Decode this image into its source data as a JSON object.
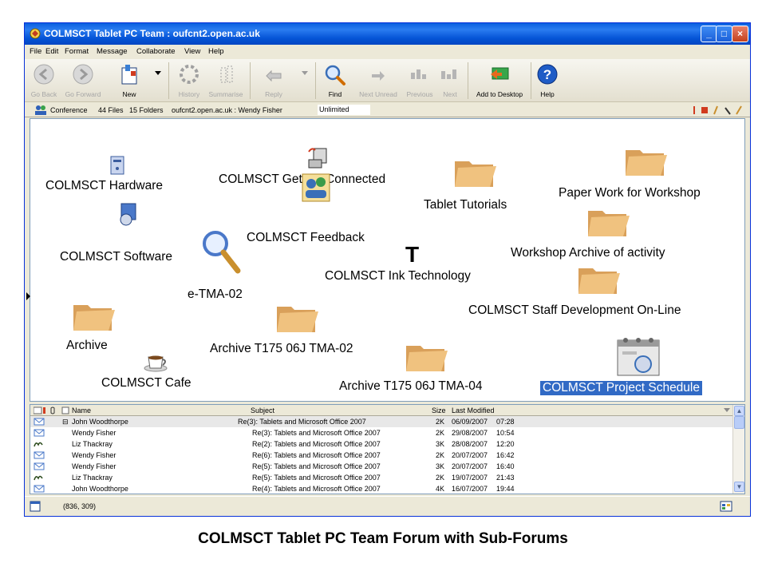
{
  "window": {
    "title": "COLMSCT Tablet PC Team : oufcnt2.open.ac.uk"
  },
  "menu": [
    "File",
    "Edit",
    "Format",
    "Message",
    "Collaborate",
    "View",
    "Help"
  ],
  "toolbar": {
    "go_back": "Go Back",
    "go_forward": "Go Forward",
    "new": "New",
    "history": "History",
    "summarise": "Summarise",
    "reply": "Reply",
    "find": "Find",
    "next_unread": "Next Unread",
    "previous": "Previous",
    "next": "Next",
    "add_to_desktop": "Add to Desktop",
    "help": "Help"
  },
  "infobar": {
    "type": "Conference",
    "files": "44 Files",
    "folders": "15 Folders",
    "location": "oufcnt2.open.ac.uk : Wendy Fisher",
    "quota": "Unlimited"
  },
  "forum": {
    "items": {
      "hardware": "COLMSCT Hardware",
      "getting_connected": "COLMSCT Getting Connected",
      "tablet_tutorials": "Tablet Tutorials",
      "paper_work": "Paper Work for Workshop",
      "feedback": "COLMSCT Feedback",
      "software": "COLMSCT Software",
      "workshop_archive": "Workshop Archive of activity",
      "etma": "e-TMA-02",
      "ink_tech": "COLMSCT Ink Technology",
      "staff_dev": "COLMSCT Staff Development On-Line",
      "archive": "Archive",
      "archive_tma02": "Archive T175 06J TMA-02",
      "cafe": "COLMSCT Cafe",
      "archive_tma04": "Archive T175 06J TMA-04",
      "project_schedule": "COLMSCT Project Schedule"
    },
    "big_letter": "T"
  },
  "messages": {
    "headers": {
      "name": "Name",
      "subject": "Subject",
      "size": "Size",
      "modified": "Last Modified"
    },
    "rows": [
      {
        "name": "John Woodthorpe",
        "subject": "Re(3): Tablets and Microsoft Office 2007",
        "size": "2K",
        "date": "06/09/2007",
        "time": "07:28",
        "icon": "message-icon"
      },
      {
        "name": "Wendy Fisher",
        "subject": "Re(3): Tablets and Microsoft Office 2007",
        "size": "2K",
        "date": "29/08/2007",
        "time": "10:54",
        "icon": "message-icon"
      },
      {
        "name": "Liz Thackray",
        "subject": "Re(2): Tablets and Microsoft Office 2007",
        "size": "3K",
        "date": "28/08/2007",
        "time": "12:20",
        "icon": "ink-icon"
      },
      {
        "name": "Wendy Fisher",
        "subject": "Re(6): Tablets and Microsoft Office 2007",
        "size": "2K",
        "date": "20/07/2007",
        "time": "16:42",
        "icon": "message-icon"
      },
      {
        "name": "Wendy Fisher",
        "subject": "Re(5): Tablets and Microsoft Office 2007",
        "size": "3K",
        "date": "20/07/2007",
        "time": "16:40",
        "icon": "message-icon"
      },
      {
        "name": "Liz Thackray",
        "subject": "Re(5): Tablets and Microsoft Office 2007",
        "size": "2K",
        "date": "19/07/2007",
        "time": "21:43",
        "icon": "ink-icon"
      },
      {
        "name": "John Woodthorpe",
        "subject": "Re(4): Tablets and Microsoft Office 2007",
        "size": "4K",
        "date": "16/07/2007",
        "time": "19:44",
        "icon": "message-icon"
      }
    ]
  },
  "status": {
    "coords": "(836, 309)"
  },
  "caption": "COLMSCT Tablet PC Team Forum with Sub-Forums",
  "colors": {
    "titlebar": "#0554d6",
    "selection": "#316ac5",
    "folder": "#e9b96e"
  }
}
